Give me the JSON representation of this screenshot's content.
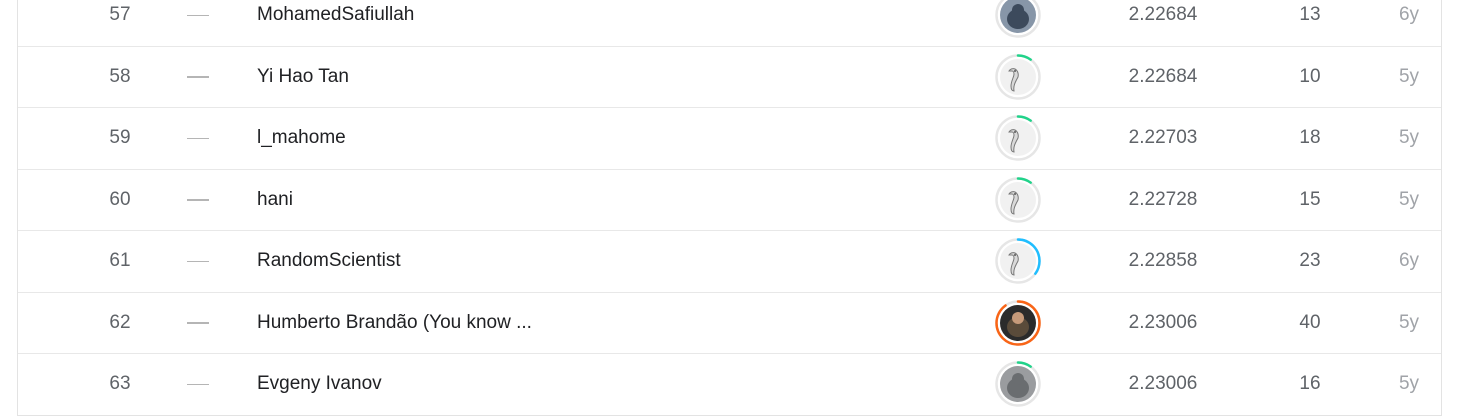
{
  "leaderboard": {
    "rows": [
      {
        "rank": "57",
        "delta": "—",
        "team": "MohamedSafiullah",
        "avatar_icon": "user-photo-avatar",
        "tier_color": "#20beff",
        "progress": 0.1,
        "score": "2.22684",
        "entries": "13",
        "last": "6y"
      },
      {
        "rank": "58",
        "delta": "—",
        "team": "Yi Hao Tan",
        "avatar_icon": "default-goose-avatar",
        "tier_color": "#20beff",
        "progress": 0.1,
        "score": "2.22684",
        "entries": "10",
        "last": "5y"
      },
      {
        "rank": "59",
        "delta": "—",
        "team": "l_mahome",
        "avatar_icon": "default-goose-avatar",
        "tier_color": "#20beff",
        "progress": 0.1,
        "score": "2.22703",
        "entries": "18",
        "last": "5y"
      },
      {
        "rank": "60",
        "delta": "—",
        "team": "hani",
        "avatar_icon": "default-goose-avatar",
        "tier_color": "#20beff",
        "progress": 0.1,
        "score": "2.22728",
        "entries": "15",
        "last": "5y"
      },
      {
        "rank": "61",
        "delta": "—",
        "team": "RandomScientist",
        "avatar_icon": "default-goose-avatar",
        "tier_color": "#20beff",
        "progress": 0.35,
        "score": "2.22858",
        "entries": "23",
        "last": "6y"
      },
      {
        "rank": "62",
        "delta": "—",
        "team": "Humberto Brandão (You know ...",
        "avatar_icon": "user-photo-avatar",
        "tier_color": "#f96517",
        "progress": 0.9,
        "score": "2.23006",
        "entries": "40",
        "last": "5y"
      },
      {
        "rank": "63",
        "delta": "—",
        "team": "Evgeny Ivanov",
        "avatar_icon": "user-photo-avatar",
        "tier_color": "#20beff",
        "progress": 0.1,
        "score": "2.23006",
        "entries": "16",
        "last": "5y"
      }
    ]
  }
}
